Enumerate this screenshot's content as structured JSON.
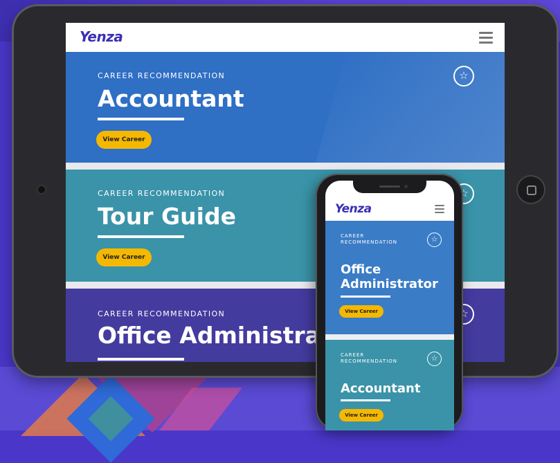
{
  "brand": {
    "logo_text": "Yenza",
    "accent": "#3a2fb5",
    "button_color": "#f5b800"
  },
  "tablet": {
    "cards": [
      {
        "kicker": "CAREER RECOMMENDATION",
        "title": "Accountant",
        "button": "View Career",
        "color": "#2f6fc4"
      },
      {
        "kicker": "CAREER RECOMMENDATION",
        "title": "Tour Guide",
        "button": "View Career",
        "color": "#3a93a8"
      },
      {
        "kicker": "CAREER RECOMMENDATION",
        "title": "Office Administrat",
        "color": "#433b9e"
      }
    ]
  },
  "phone": {
    "cards": [
      {
        "kicker": "CAREER RECOMMENDATION",
        "title": "Office Administrator",
        "button": "View Career",
        "color": "#3a7cc6"
      },
      {
        "kicker": "CAREER RECOMMENDATION",
        "title": "Accountant",
        "button": "View Career",
        "color": "#3a93a8"
      }
    ]
  },
  "icons": {
    "star": "star-icon",
    "menu": "hamburger-menu-icon",
    "star_glyph": "☆"
  }
}
